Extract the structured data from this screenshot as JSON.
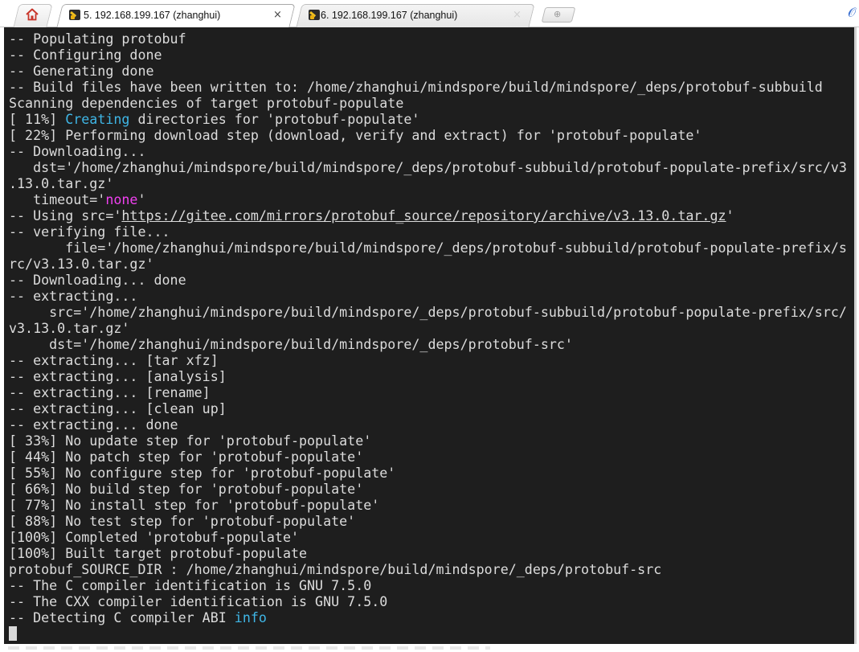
{
  "tabs": {
    "home_icon": "home-icon",
    "items": [
      {
        "title": "5. 192.168.199.167 (zhanghui)",
        "icon": "terminal-icon",
        "active": true,
        "close": "×"
      },
      {
        "title": "6. 192.168.199.167 (zhanghui)",
        "icon": "terminal-icon",
        "active": false,
        "close": "×"
      }
    ],
    "new_tab_icon": "plus-icon",
    "attach_icon": "paperclip-icon"
  },
  "terminal": {
    "background": "#1e1e1e",
    "foreground": "#dcdcdc",
    "accent_cyan": "#3fb6e6",
    "accent_magenta": "#f040f0",
    "lines": [
      [
        {
          "t": "-- Populating protobuf"
        }
      ],
      [
        {
          "t": "-- Configuring done"
        }
      ],
      [
        {
          "t": "-- Generating done"
        }
      ],
      [
        {
          "t": "-- Build files have been written to: /home/zhanghui/mindspore/build/mindspore/_deps/protobuf-subbuild"
        }
      ],
      [
        {
          "t": "Scanning dependencies of target protobuf-populate"
        }
      ],
      [
        {
          "t": "[ 11%] "
        },
        {
          "t": "Creating",
          "c": "cyan"
        },
        {
          "t": " directories for 'protobuf-populate'"
        }
      ],
      [
        {
          "t": "[ 22%] Performing download step (download, verify and extract) for 'protobuf-populate'"
        }
      ],
      [
        {
          "t": "-- Downloading..."
        }
      ],
      [
        {
          "t": "   dst='/home/zhanghui/mindspore/build/mindspore/_deps/protobuf-subbuild/protobuf-populate-prefix/src/v3"
        }
      ],
      [
        {
          "t": ".13.0.tar.gz'"
        }
      ],
      [
        {
          "t": "   timeout='"
        },
        {
          "t": "none",
          "c": "magenta"
        },
        {
          "t": "'"
        }
      ],
      [
        {
          "t": "-- Using src='"
        },
        {
          "t": "https://gitee.com/mirrors/protobuf_source/repository/archive/v3.13.0.tar.gz",
          "c": "link"
        },
        {
          "t": "'"
        }
      ],
      [
        {
          "t": "-- verifying file..."
        }
      ],
      [
        {
          "t": "       file='/home/zhanghui/mindspore/build/mindspore/_deps/protobuf-subbuild/protobuf-populate-prefix/s"
        }
      ],
      [
        {
          "t": "rc/v3.13.0.tar.gz'"
        }
      ],
      [
        {
          "t": "-- Downloading... done"
        }
      ],
      [
        {
          "t": "-- extracting..."
        }
      ],
      [
        {
          "t": "     src='/home/zhanghui/mindspore/build/mindspore/_deps/protobuf-subbuild/protobuf-populate-prefix/src/"
        }
      ],
      [
        {
          "t": "v3.13.0.tar.gz'"
        }
      ],
      [
        {
          "t": "     dst='/home/zhanghui/mindspore/build/mindspore/_deps/protobuf-src'"
        }
      ],
      [
        {
          "t": "-- extracting... [tar xfz]"
        }
      ],
      [
        {
          "t": "-- extracting... [analysis]"
        }
      ],
      [
        {
          "t": "-- extracting... [rename]"
        }
      ],
      [
        {
          "t": "-- extracting... [clean up]"
        }
      ],
      [
        {
          "t": "-- extracting... done"
        }
      ],
      [
        {
          "t": "[ 33%] No update step for 'protobuf-populate'"
        }
      ],
      [
        {
          "t": "[ 44%] No patch step for 'protobuf-populate'"
        }
      ],
      [
        {
          "t": "[ 55%] No configure step for 'protobuf-populate'"
        }
      ],
      [
        {
          "t": "[ 66%] No build step for 'protobuf-populate'"
        }
      ],
      [
        {
          "t": "[ 77%] No install step for 'protobuf-populate'"
        }
      ],
      [
        {
          "t": "[ 88%] No test step for 'protobuf-populate'"
        }
      ],
      [
        {
          "t": "[100%] Completed 'protobuf-populate'"
        }
      ],
      [
        {
          "t": "[100%] Built target protobuf-populate"
        }
      ],
      [
        {
          "t": "protobuf_SOURCE_DIR : /home/zhanghui/mindspore/build/mindspore/_deps/protobuf-src"
        }
      ],
      [
        {
          "t": "-- The C compiler identification is GNU 7.5.0"
        }
      ],
      [
        {
          "t": "-- The CXX compiler identification is GNU 7.5.0"
        }
      ],
      [
        {
          "t": "-- Detecting C compiler ABI "
        },
        {
          "t": "info",
          "c": "cyan"
        }
      ]
    ]
  }
}
